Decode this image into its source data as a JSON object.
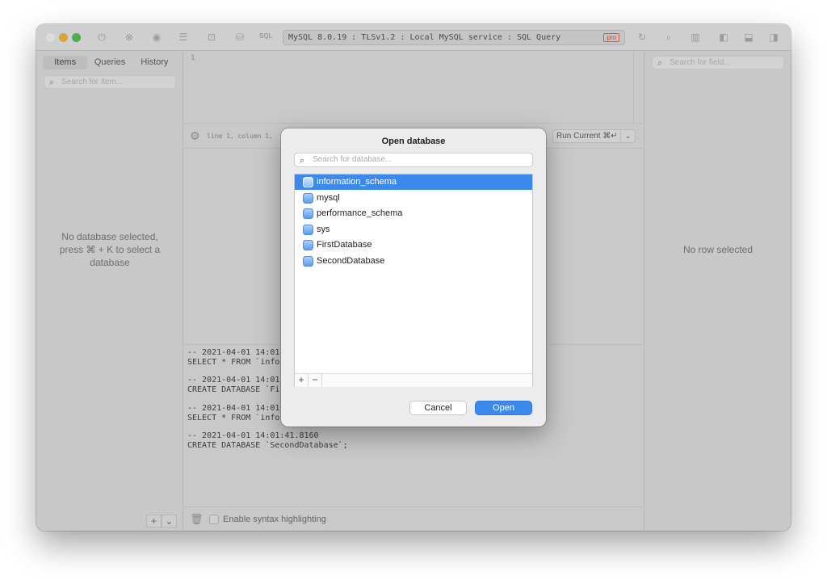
{
  "titlebar": {
    "sql_label": "SQL",
    "address": "MySQL 8.0.19 : TLSv1.2 : Local MySQL service : SQL Query",
    "badge": "pro"
  },
  "sidebar": {
    "tabs": [
      "Items",
      "Queries",
      "History"
    ],
    "search_placeholder": "Search for item...",
    "empty_message_lines": [
      "No database selected,",
      "press ⌘ + K to select a",
      "database"
    ],
    "add_button": "+",
    "menu_button": "⌄"
  },
  "editor": {
    "line_number": "1",
    "status": "line 1, column 1,",
    "run_button": "Run Current ⌘↵",
    "run_chevron": "⌄"
  },
  "log": {
    "lines": [
      "-- 2021-04-01 14:01:",
      "SELECT * FROM `infor",
      "-- 2021-04-01 14:01:",
      "CREATE DATABASE `Fir",
      "-- 2021-04-01 14:01:",
      "SELECT * FROM `infor",
      "-- 2021-04-01 14:01:41.8160",
      "CREATE DATABASE `SecondDatabase`;"
    ]
  },
  "bottom": {
    "syntax_label": "Enable syntax highlighting"
  },
  "rightpane": {
    "search_placeholder": "Search for field...",
    "empty_message": "No row selected"
  },
  "dialog": {
    "title": "Open database",
    "search_placeholder": "Search for database...",
    "databases": [
      "information_schema",
      "mysql",
      "performance_schema",
      "sys",
      "FirstDatabase",
      "SecondDatabase"
    ],
    "selected": "information_schema",
    "add_label": "+",
    "remove_label": "−",
    "cancel_label": "Cancel",
    "open_label": "Open"
  },
  "colors": {
    "accent": "#3b89ea",
    "traffic_red": "#d9d9d9",
    "traffic_yellow": "#d4aa3a",
    "traffic_green": "#4caf50"
  }
}
